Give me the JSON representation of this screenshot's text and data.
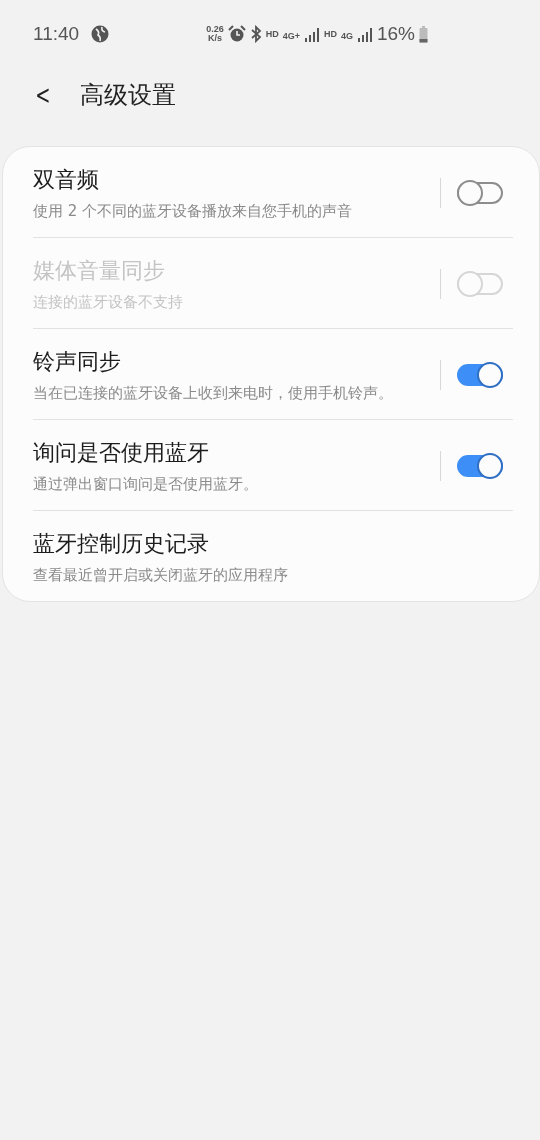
{
  "status_bar": {
    "time": "11:40",
    "speed_value": "0.26",
    "speed_unit": "K/s",
    "hd_1": "HD",
    "network_1": "4G+",
    "hd_2": "HD",
    "network_2": "4G",
    "battery": "16%"
  },
  "header": {
    "back": "<",
    "title": "高级设置"
  },
  "items": [
    {
      "kind": "switch",
      "title": "双音频",
      "subtitle": "使用 2 个不同的蓝牙设备播放来自您手机的声音",
      "on": false,
      "disabled": false
    },
    {
      "kind": "switch",
      "title": "媒体音量同步",
      "subtitle": "连接的蓝牙设备不支持",
      "on": false,
      "disabled": true
    },
    {
      "kind": "switch",
      "title": "铃声同步",
      "subtitle": "当在已连接的蓝牙设备上收到来电时，使用手机铃声。",
      "on": true,
      "disabled": false
    },
    {
      "kind": "switch",
      "title": "询问是否使用蓝牙",
      "subtitle": "通过弹出窗口询问是否使用蓝牙。",
      "on": true,
      "disabled": false
    },
    {
      "kind": "link",
      "title": "蓝牙控制历史记录",
      "subtitle": "查看最近曾开启或关闭蓝牙的应用程序",
      "disabled": false
    }
  ]
}
